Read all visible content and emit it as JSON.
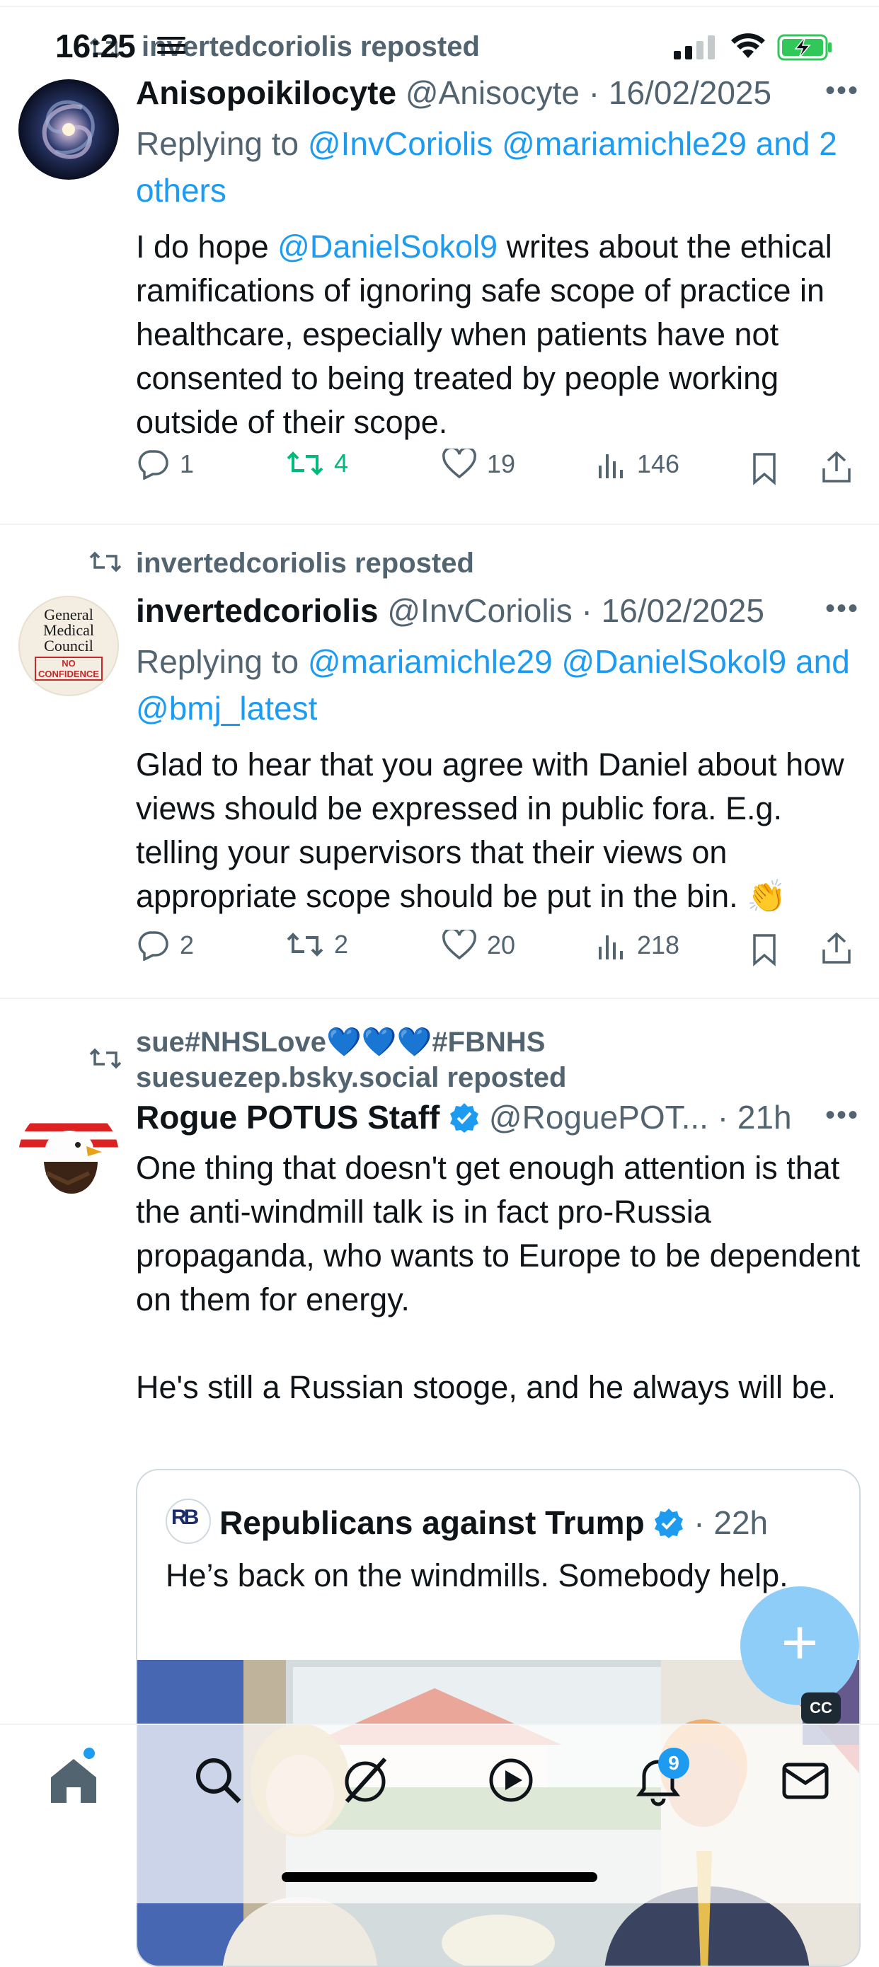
{
  "status_bar": {
    "time": "16:25"
  },
  "top_repost_label": "invertedcoriolis reposted",
  "tweets": [
    {
      "name": "Anisopoikilocyte",
      "handle": "@Anisocyte",
      "date": "16/02/2025",
      "reply_prefix": "Replying to ",
      "reply_links": "@InvCoriolis @mariamichle29 and 2 others",
      "body_prefix": "I do hope ",
      "body_mention": "@DanielSokol9",
      "body_rest": " writes about the ethical ramifications of ignoring safe scope of practice in healthcare, especially when patients have not consented to being treated by people working outside of their scope.",
      "replies": "1",
      "reposts": "4",
      "likes": "19",
      "views": "146"
    },
    {
      "repost_label": "invertedcoriolis reposted",
      "name": "invertedcoriolis",
      "handle": "@InvCoriolis",
      "date": "16/02/2025",
      "reply_prefix": "Replying to ",
      "reply_links": "@mariamichle29 @DanielSokol9 and @bmj_latest",
      "body": "Glad to hear that you agree with Daniel about how views should be expressed in public fora. E.g. telling your supervisors that their views on appropriate scope should be put in the bin. 👏",
      "avatar_text": {
        "line1": "General",
        "line2": "Medical",
        "line3": "Council",
        "stamp1": "NO",
        "stamp2": "CONFIDENCE"
      },
      "replies": "2",
      "reposts": "2",
      "likes": "20",
      "views": "218"
    },
    {
      "repost_label_line1": "sue#NHSLove💙💙💙#FBNHS",
      "repost_label_line2": "suesuezep.bsky.social reposted",
      "name": "Rogue POTUS Staff",
      "handle": "@RoguePOT...",
      "time": "21h",
      "body_p1": "One thing that doesn't get enough attention is that the anti-windmill talk is in fact pro-Russia propaganda, who wants to Europe to be dependent on them for energy.",
      "body_p2": "He's still a Russian stooge, and he always will be.",
      "quote": {
        "avatar_text": "RB",
        "name": "Republicans against Trump",
        "time": "22h",
        "body": "He’s back on the windmills. Somebody help."
      }
    }
  ],
  "separator": " · ",
  "fab_label": "+",
  "cc_label": "CC",
  "tab_bar": {
    "notifications_badge": "9"
  },
  "colors": {
    "accent": "#1d9bf0",
    "repost_green": "#00ba7c",
    "muted": "#536471",
    "text": "#0f1419"
  }
}
